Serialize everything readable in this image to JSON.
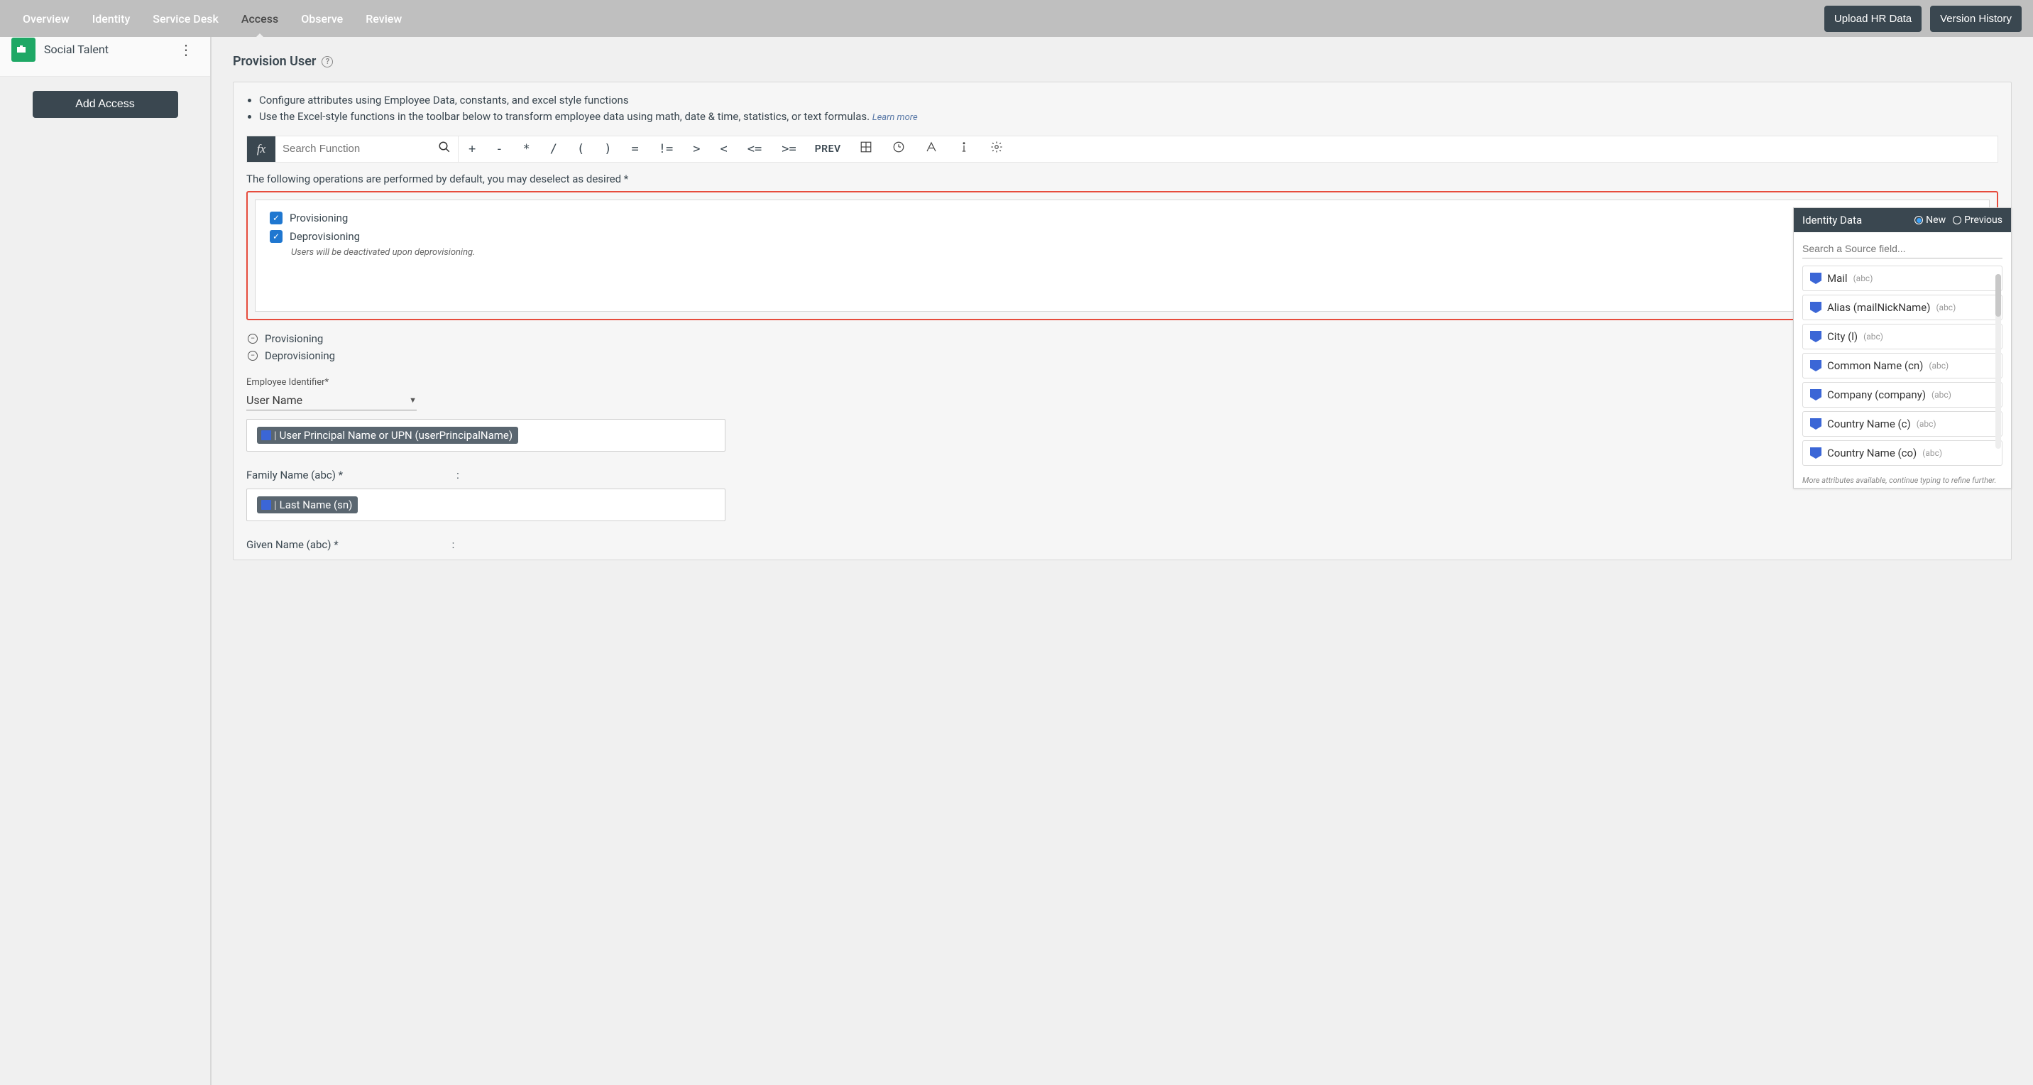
{
  "topbar": {
    "tabs": [
      {
        "label": "Overview"
      },
      {
        "label": "Identity"
      },
      {
        "label": "Service Desk"
      },
      {
        "label": "Access"
      },
      {
        "label": "Observe"
      },
      {
        "label": "Review"
      }
    ],
    "active_tab": "Access",
    "buttons": {
      "upload": "Upload HR Data",
      "version": "Version History"
    }
  },
  "sidebar": {
    "app_name": "Social Talent",
    "add_button": "Add Access"
  },
  "page": {
    "title": "Provision User"
  },
  "config": {
    "bullets": [
      "Configure attributes using Employee Data, constants, and excel style functions",
      "Use the Excel-style functions in the toolbar below to transform employee data using math, date & time, statistics, or text formulas."
    ],
    "learn_more": "Learn more"
  },
  "fx": {
    "search_placeholder": "Search Function",
    "ops": [
      "+",
      "-",
      "*",
      "/",
      "(",
      ")",
      "=",
      "!=",
      ">",
      "<",
      "<=",
      ">="
    ],
    "prev": "PREV"
  },
  "operations": {
    "intro": "The following operations are performed by default, you may deselect as desired *",
    "provisioning": {
      "label": "Provisioning",
      "checked": true
    },
    "deprovisioning": {
      "label": "Deprovisioning",
      "checked": true,
      "note": "Users will be deactivated upon deprovisioning."
    },
    "collapse_prov": "Provisioning",
    "collapse_deprov": "Deprovisioning"
  },
  "employee_id": {
    "label": "Employee Identifier*",
    "value": "User Name",
    "chip": "User Principal Name or UPN (userPrincipalName)"
  },
  "family_name": {
    "label": "Family Name (abc) *",
    "chip": "Last Name (sn)"
  },
  "given_name": {
    "label": "Given Name (abc) *"
  },
  "identity_panel": {
    "title": "Identity Data",
    "radio_new": "New",
    "radio_prev": "Previous",
    "search_placeholder": "Search a Source field...",
    "fields": [
      {
        "name": "Mail",
        "type": "(abc)"
      },
      {
        "name": "Alias (mailNickName)",
        "type": "(abc)"
      },
      {
        "name": "City (l)",
        "type": "(abc)"
      },
      {
        "name": "Common Name (cn)",
        "type": "(abc)"
      },
      {
        "name": "Company (company)",
        "type": "(abc)"
      },
      {
        "name": "Country Name (c)",
        "type": "(abc)"
      },
      {
        "name": "Country Name (co)",
        "type": "(abc)"
      }
    ],
    "more": "More attributes available, continue typing to refine further."
  }
}
